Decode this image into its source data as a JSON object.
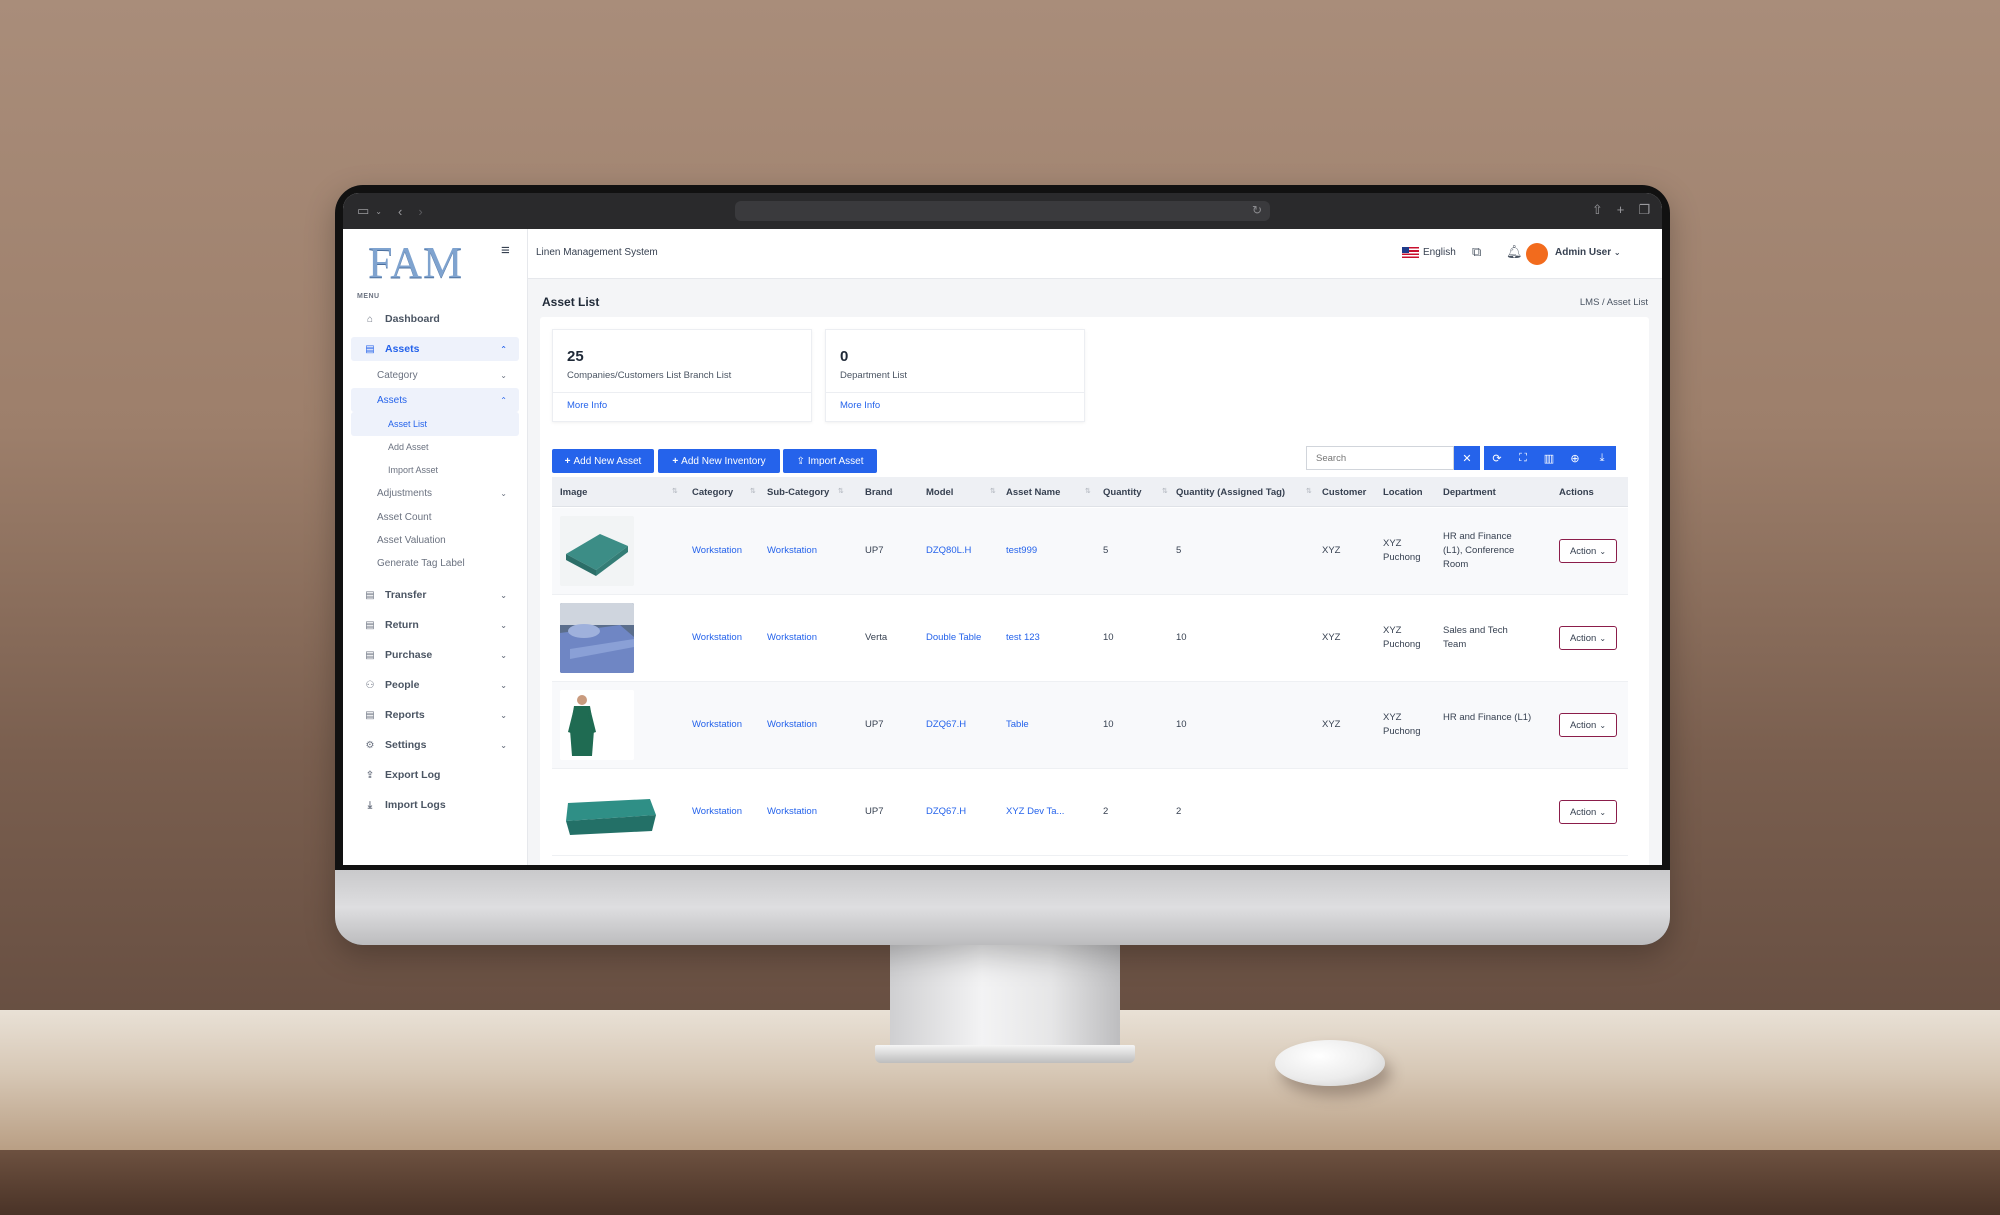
{
  "app": {
    "title": "Linen Management System",
    "logo": "FAM",
    "menu_label": "MENU"
  },
  "header": {
    "language": "English",
    "user": "Admin User"
  },
  "sidebar": {
    "items": [
      {
        "label": "Dashboard",
        "icon": "home-icon"
      },
      {
        "label": "Assets",
        "icon": "building-icon",
        "expanded": true
      },
      {
        "label": "Category"
      },
      {
        "label": "Assets",
        "expanded": true
      },
      {
        "label": "Asset List"
      },
      {
        "label": "Add Asset"
      },
      {
        "label": "Import Asset"
      },
      {
        "label": "Adjustments"
      },
      {
        "label": "Asset Count"
      },
      {
        "label": "Asset Valuation"
      },
      {
        "label": "Generate Tag Label"
      },
      {
        "label": "Transfer",
        "icon": "building-icon"
      },
      {
        "label": "Return",
        "icon": "building-icon"
      },
      {
        "label": "Purchase",
        "icon": "building-icon"
      },
      {
        "label": "People",
        "icon": "people-icon"
      },
      {
        "label": "Reports",
        "icon": "building-icon"
      },
      {
        "label": "Settings",
        "icon": "gear-icon"
      },
      {
        "label": "Export Log",
        "icon": "upload-icon"
      },
      {
        "label": "Import Logs",
        "icon": "download-icon"
      }
    ]
  },
  "page": {
    "title": "Asset List",
    "breadcrumb": "LMS  /  Asset List"
  },
  "stats": [
    {
      "value": "25",
      "label": "Companies/Customers List Branch List",
      "link": "More Info"
    },
    {
      "value": "0",
      "label": "Department List",
      "link": "More Info"
    }
  ],
  "toolbar": {
    "add_asset": "Add New Asset",
    "add_inventory": "Add New Inventory",
    "import_asset": "Import Asset",
    "search_placeholder": "Search"
  },
  "table": {
    "headers": [
      "Image",
      "Category",
      "Sub-Category",
      "Brand",
      "Model",
      "Asset Name",
      "Quantity",
      "Quantity (Assigned Tag)",
      "Customer",
      "Location",
      "Department",
      "Actions"
    ],
    "rows": [
      {
        "category": "Workstation",
        "subcategory": "Workstation",
        "brand": "UP7",
        "model": "DZQ80L.H",
        "name": "test999",
        "qty": "5",
        "qty_tag": "5",
        "customer": "XYZ",
        "location": "XYZ Puchong",
        "department": "HR and Finance (L1), Conference Room",
        "action": "Action"
      },
      {
        "category": "Workstation",
        "subcategory": "Workstation",
        "brand": "Verta",
        "model": "Double Table",
        "name": "test 123",
        "qty": "10",
        "qty_tag": "10",
        "customer": "XYZ",
        "location": "XYZ Puchong",
        "department": "Sales and Tech Team",
        "action": "Action"
      },
      {
        "category": "Workstation",
        "subcategory": "Workstation",
        "brand": "UP7",
        "model": "DZQ67.H",
        "name": "Table",
        "qty": "10",
        "qty_tag": "10",
        "customer": "XYZ",
        "location": "XYZ Puchong",
        "department": "HR and Finance (L1)",
        "action": "Action"
      },
      {
        "category": "Workstation",
        "subcategory": "Workstation",
        "brand": "UP7",
        "model": "DZQ67.H",
        "name": "XYZ Dev Ta...",
        "qty": "2",
        "qty_tag": "2",
        "customer": "",
        "location": "",
        "department": "",
        "action": "Action"
      }
    ]
  },
  "colors": {
    "primary": "#2563eb",
    "avatar": "#f26b1d",
    "action_border": "#8b1d4a"
  }
}
